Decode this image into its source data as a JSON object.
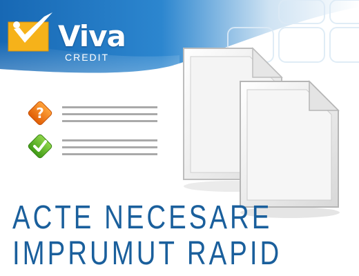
{
  "logo": {
    "brand": "Viva",
    "subtitle": "CREDIT"
  },
  "checklist": [
    {
      "icon": "question-mark-icon",
      "color": "#f07a10"
    },
    {
      "icon": "checkmark-icon",
      "color": "#5bb52a"
    }
  ],
  "title": {
    "line1": "ACTE NECESARE",
    "line2": "IMPRUMUT RAPID"
  },
  "colors": {
    "header_blue": "#1a6bb5",
    "title_blue": "#1a5f9c",
    "logo_yellow": "#f6b21a"
  }
}
